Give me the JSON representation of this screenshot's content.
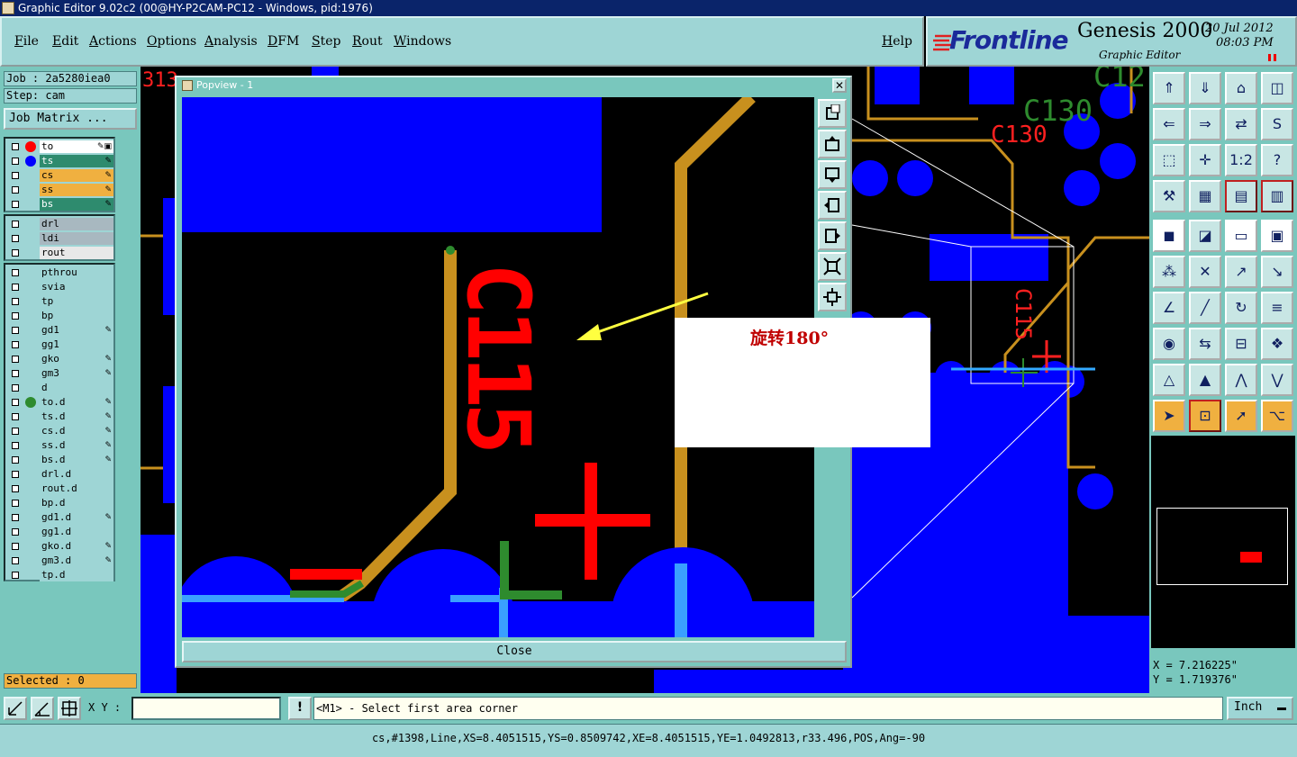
{
  "window": {
    "title": "Graphic Editor 9.02c2 (00@HY-P2CAM-PC12 - Windows, pid:1976)"
  },
  "menu": [
    "File",
    "Edit",
    "Actions",
    "Options",
    "Analysis",
    "DFM",
    "Step",
    "Rout",
    "Windows"
  ],
  "help_label": "Help",
  "brand": {
    "logo": "Frontline",
    "product": "Genesis 2000",
    "subtitle": "Graphic Editor",
    "date": "20 Jul 2012",
    "time": "08:03 PM"
  },
  "job": {
    "job_label": "Job : 2a5280iea0",
    "step_label": "Step: cam",
    "matrix_button": "Job Matrix ..."
  },
  "layer_groups": [
    [
      {
        "name": "to",
        "color": "#ffffff",
        "dot": "#ff0000",
        "flag": "✎▣"
      },
      {
        "name": "ts",
        "color": "#2e8b6e",
        "dot": "#0000ff",
        "flag": "✎"
      },
      {
        "name": "cs",
        "color": "#f0b040",
        "dot": "",
        "flag": "✎"
      },
      {
        "name": "ss",
        "color": "#f0b040",
        "dot": "",
        "flag": "✎"
      },
      {
        "name": "bs",
        "color": "#2e8b6e",
        "dot": "",
        "flag": "✎"
      }
    ],
    [
      {
        "name": "drl",
        "color": "#a8b8c0",
        "dot": "",
        "flag": ""
      },
      {
        "name": "ldi",
        "color": "#a8b8c0",
        "dot": "",
        "flag": ""
      },
      {
        "name": "rout",
        "color": "#e8e8e8",
        "dot": "",
        "flag": ""
      }
    ],
    [
      {
        "name": "pthrou",
        "color": "#9ed5d5",
        "dot": "",
        "flag": ""
      },
      {
        "name": "svia",
        "color": "#9ed5d5",
        "dot": "",
        "flag": ""
      },
      {
        "name": "tp",
        "color": "#9ed5d5",
        "dot": "",
        "flag": ""
      },
      {
        "name": "bp",
        "color": "#9ed5d5",
        "dot": "",
        "flag": ""
      },
      {
        "name": "gd1",
        "color": "#9ed5d5",
        "dot": "",
        "flag": "✎"
      },
      {
        "name": "gg1",
        "color": "#9ed5d5",
        "dot": "",
        "flag": ""
      },
      {
        "name": "gko",
        "color": "#9ed5d5",
        "dot": "",
        "flag": "✎"
      },
      {
        "name": "gm3",
        "color": "#9ed5d5",
        "dot": "",
        "flag": "✎"
      },
      {
        "name": "d",
        "color": "#9ed5d5",
        "dot": "",
        "flag": ""
      },
      {
        "name": "to.d",
        "color": "#9ed5d5",
        "dot": "#2e8b2e",
        "flag": "✎"
      },
      {
        "name": "ts.d",
        "color": "#9ed5d5",
        "dot": "",
        "flag": "✎"
      },
      {
        "name": "cs.d",
        "color": "#9ed5d5",
        "dot": "",
        "flag": "✎"
      },
      {
        "name": "ss.d",
        "color": "#9ed5d5",
        "dot": "",
        "flag": "✎"
      },
      {
        "name": "bs.d",
        "color": "#9ed5d5",
        "dot": "",
        "flag": "✎"
      },
      {
        "name": "drl.d",
        "color": "#9ed5d5",
        "dot": "",
        "flag": ""
      },
      {
        "name": "rout.d",
        "color": "#9ed5d5",
        "dot": "",
        "flag": ""
      },
      {
        "name": "bp.d",
        "color": "#9ed5d5",
        "dot": "",
        "flag": ""
      },
      {
        "name": "gd1.d",
        "color": "#9ed5d5",
        "dot": "",
        "flag": "✎"
      },
      {
        "name": "gg1.d",
        "color": "#9ed5d5",
        "dot": "",
        "flag": ""
      },
      {
        "name": "gko.d",
        "color": "#9ed5d5",
        "dot": "",
        "flag": "✎"
      },
      {
        "name": "gm3.d",
        "color": "#9ed5d5",
        "dot": "",
        "flag": "✎"
      },
      {
        "name": "tp.d",
        "color": "#9ed5d5",
        "dot": "",
        "flag": ""
      }
    ]
  ],
  "selected": "Selected : 0",
  "popview": {
    "title": "Popview - 1",
    "close_label": "Close",
    "annotation": "旋转180°"
  },
  "canvas_labels": {
    "c130_green": "C130",
    "c130_red": "C130",
    "c12": "C12",
    "c115": "C115",
    "popup_c115": "C115",
    "left_edge": "313"
  },
  "coords": {
    "x": "X = 7.216225\"",
    "y": "Y = 1.719376\""
  },
  "command": {
    "xy_label": "X Y :",
    "xy_value": "",
    "prompt": "<M1> - Select first area corner",
    "unit": "Inch"
  },
  "status": "cs,#1398,Line,XS=8.4051515,YS=0.8509742,XE=8.4051515,YE=1.0492813,r33.496,POS,Ang=-90",
  "colors": {
    "accent_teal": "#79c7bd",
    "panel_light": "#9ed5d5",
    "copper": "#0000ff",
    "silk": "#ff0000",
    "trace": "#c8901e"
  },
  "toolbar_icons": [
    "home-up-icon",
    "home-down-icon",
    "home-icon",
    "window-icon",
    "pan-left-icon",
    "pan-right-icon",
    "swap-icon",
    "s-curve-icon",
    "fit-icon",
    "center-icon",
    "scale-icon",
    "help-icon",
    "tools-icon",
    "grid-icon",
    "layers-icon",
    "layers-compare-icon",
    "select-point-icon",
    "select-area-icon",
    "measure-icon",
    "net-icon",
    "connect-icon",
    "delete-icon",
    "move-icon",
    "copy-icon",
    "angle-icon",
    "line-icon",
    "rotate-icon",
    "split-icon",
    "snap-icon",
    "mirror-icon",
    "dimension-icon",
    "group-icon",
    "triangle-icon",
    "delta-icon",
    "arch-icon",
    "arch-down-icon",
    "pointer-icon",
    "pointer-box-icon",
    "pointer-select-icon",
    "route-icon"
  ]
}
